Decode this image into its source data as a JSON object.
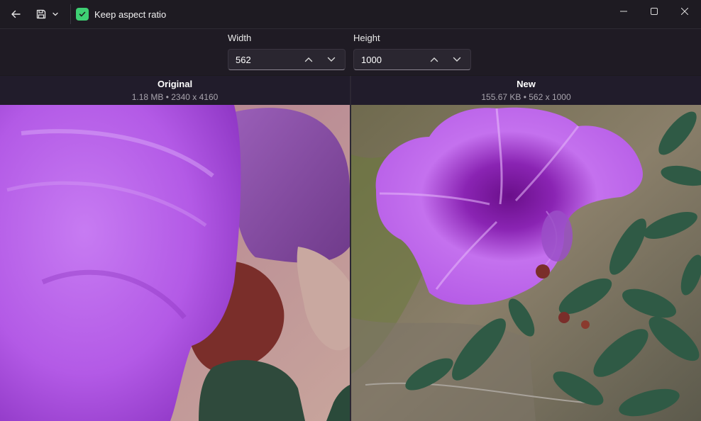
{
  "titlebar": {
    "back_icon": "arrow-left-icon",
    "save_icon": "save-icon",
    "keep_aspect": {
      "label": "Keep aspect ratio",
      "checked": true,
      "color": "#3ecf73"
    }
  },
  "resize": {
    "width": {
      "label": "Width",
      "value": "562"
    },
    "height": {
      "label": "Height",
      "value": "1000"
    }
  },
  "original": {
    "title": "Original",
    "info": "1.18 MB • 2340 x 4160"
  },
  "new": {
    "title": "New",
    "info": "155.67 KB • 562 x 1000"
  },
  "colors": {
    "accent": "#3ecf73",
    "petal": "#b35ae6",
    "leaf": "#2f5a45"
  }
}
